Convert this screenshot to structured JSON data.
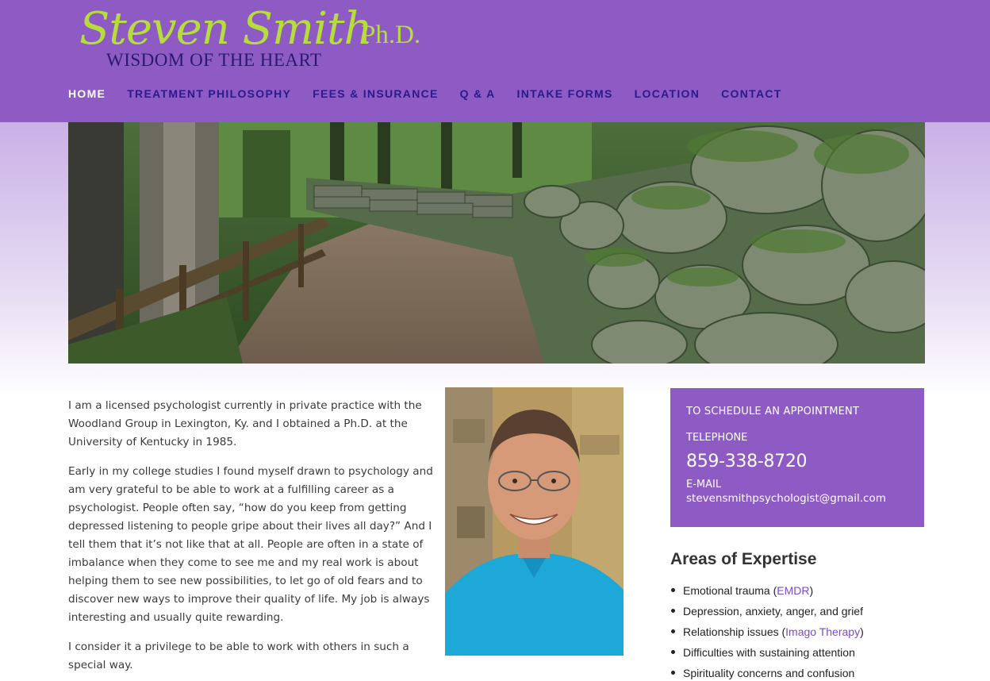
{
  "logo": {
    "name": "Steven Smith",
    "suffix": "Ph.D.",
    "tagline": "WISDOM OF THE HEART"
  },
  "nav": {
    "items": [
      {
        "label": "HOME",
        "active": true
      },
      {
        "label": "TREATMENT PHILOSOPHY"
      },
      {
        "label": "FEES & INSURANCE"
      },
      {
        "label": "Q & A"
      },
      {
        "label": "INTAKE FORMS"
      },
      {
        "label": "LOCATION"
      },
      {
        "label": "CONTACT"
      }
    ]
  },
  "bio": {
    "p1": "I am a licensed psychologist currently in private practice with the Woodland Group in Lexington, Ky. and I obtained a Ph.D. at the University of Kentucky in 1985.",
    "p2": "Early in my college studies I found myself drawn to psychology and am very grateful to be able to work at a fulfilling career as a psychologist. People often say, “how do you keep from getting depressed listening to people gripe about their lives all day?” And I tell them that it’s not like that at all. People are often in a state of imbalance when they come to see me and my real work is about helping them to see new possibilities, to let go of old fears and to discover new ways to improve their quality of life. My job is always interesting and usually quite rewarding.",
    "p3": "I consider it a privilege to be able to work with others in such a special way."
  },
  "appointment": {
    "heading": "TO SCHEDULE AN APPOINTMENT",
    "telephone_label": "TELEPHONE",
    "telephone": "859-338-8720",
    "email_label": "E-MAIL",
    "email": "stevensmithpsychologist@gmail.com"
  },
  "areas": {
    "title": "Areas of Expertise",
    "items": [
      {
        "text": "Emotional trauma (",
        "link": "EMDR",
        "after": ")"
      },
      {
        "text": "Depression, anxiety, anger, and grief"
      },
      {
        "text": "Relationship issues (",
        "link": "Imago Therapy",
        "after": ")"
      },
      {
        "text": "Difficulties with sustaining attention"
      },
      {
        "text": "Spirituality concerns and confusion"
      }
    ]
  },
  "colors": {
    "brand_purple": "#8e5bc4",
    "logo_green": "#b6dd3a",
    "nav_text": "#2b1a8a",
    "link": "#7a4cc4"
  }
}
